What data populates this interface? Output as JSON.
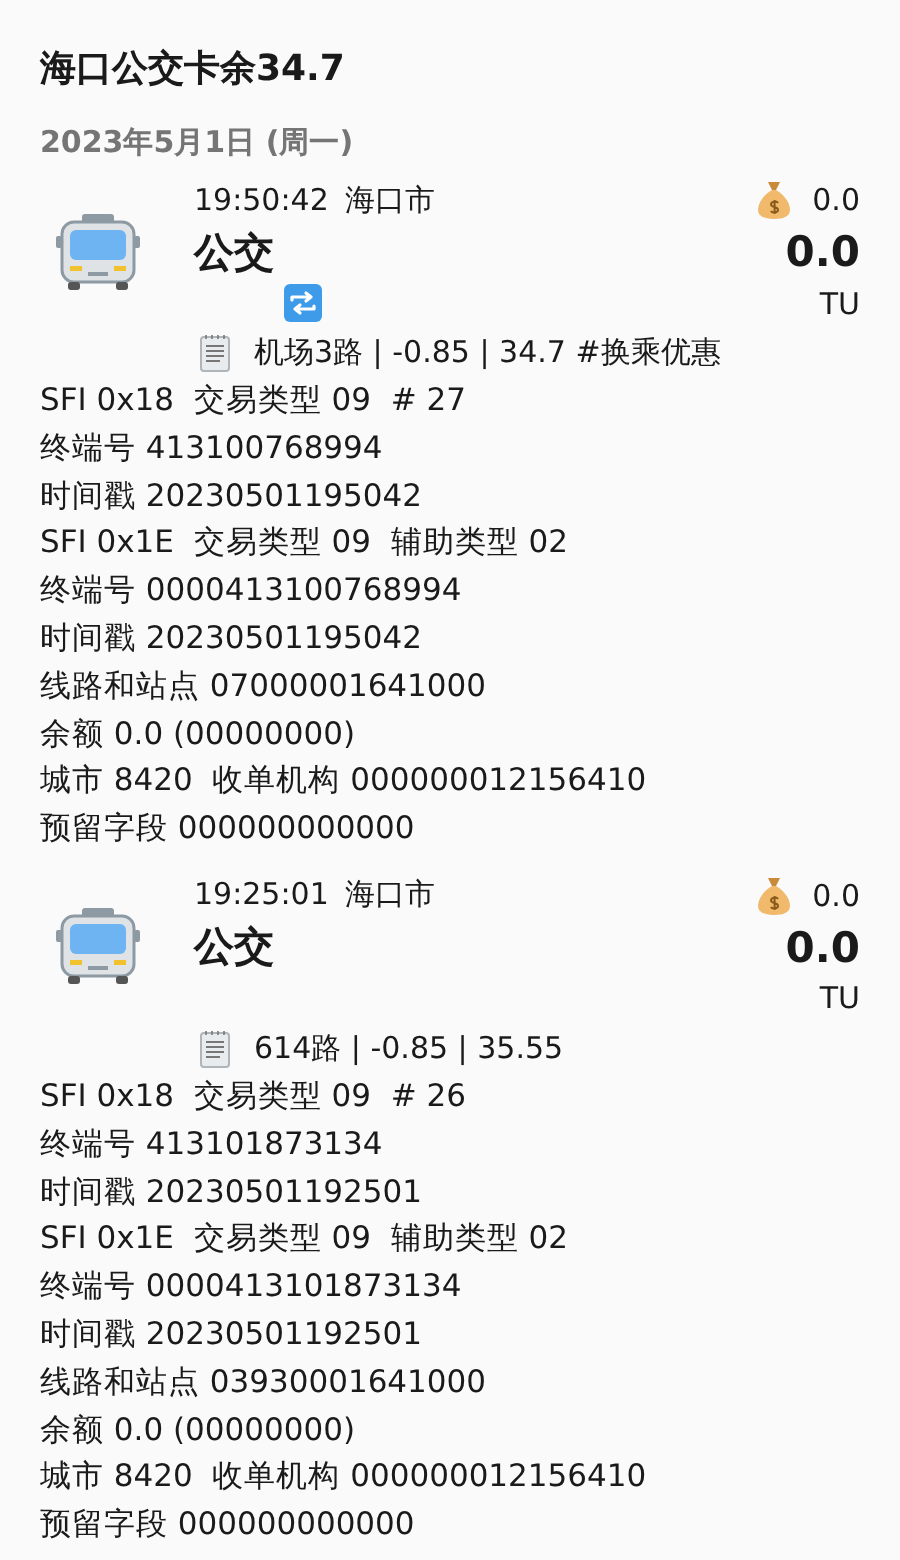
{
  "title": "海口公交卡余34.7",
  "date": "2023年5月1日 (周一)",
  "records": [
    {
      "time": "19:50:42",
      "city": "海口市",
      "category": "公交",
      "bonus": "0.0",
      "amount": "0.0",
      "unit": "TU",
      "transfer": true,
      "memo": "机场3路 | -0.85 | 34.7 #换乘优惠",
      "details": [
        "SFI 0x18  交易类型 09  # 27",
        "终端号 413100768994",
        "时间戳 20230501195042",
        "SFI 0x1E  交易类型 09  辅助类型 02",
        "终端号 0000413100768994",
        "时间戳 20230501195042",
        "线路和站点 07000001641000",
        "余额 0.0 (00000000)",
        "城市 8420  收单机构 000000012156410",
        "预留字段 000000000000"
      ]
    },
    {
      "time": "19:25:01",
      "city": "海口市",
      "category": "公交",
      "bonus": "0.0",
      "amount": "0.0",
      "unit": "TU",
      "transfer": false,
      "memo": "614路 | -0.85 | 35.55",
      "details": [
        "SFI 0x18  交易类型 09  # 26",
        "终端号 413101873134",
        "时间戳 20230501192501",
        "SFI 0x1E  交易类型 09  辅助类型 02",
        "终端号 0000413101873134",
        "时间戳 20230501192501",
        "线路和站点 03930001641000",
        "余额 0.0 (00000000)",
        "城市 8420  收单机构 000000012156410",
        "预留字段 000000000000"
      ]
    }
  ]
}
